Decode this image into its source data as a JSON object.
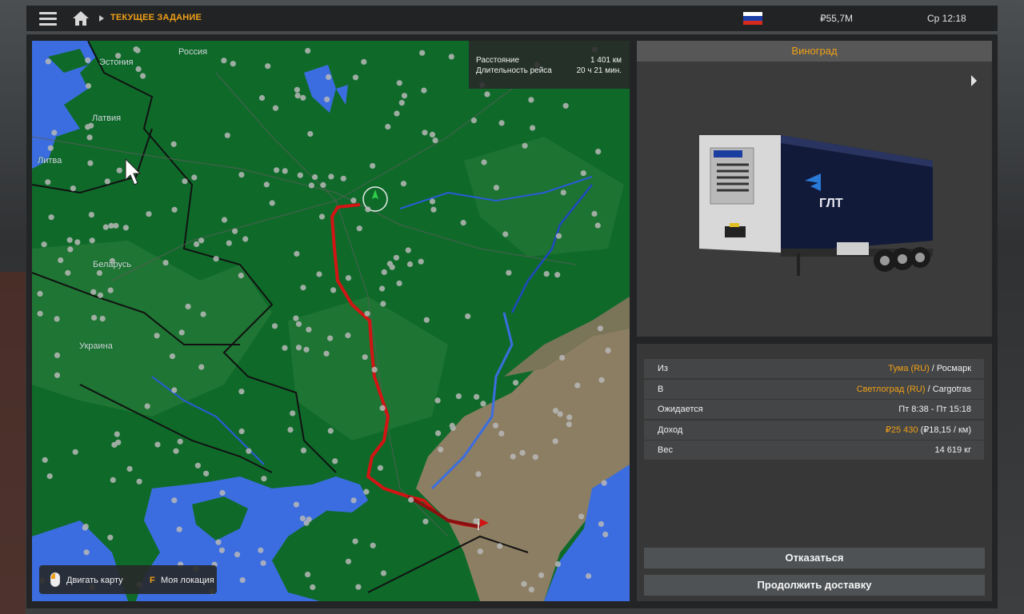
{
  "topbar": {
    "breadcrumb": "ТЕКУЩЕЕ ЗАДАНИЕ",
    "money": "₽55,7M",
    "clock": "Ср 12:18",
    "flag_colors": [
      "#ffffff",
      "#1c3ea8",
      "#d52b1e"
    ]
  },
  "map": {
    "labels": {
      "estonia": "Эстония",
      "russia": "Россия",
      "latvia": "Латвия",
      "lithuania": "Литва",
      "belarus": "Беларусь",
      "ukraine": "Украина"
    },
    "route_info": {
      "distance_label": "Расстояние",
      "distance_value": "1 401 км",
      "duration_label": "Длительность рейса",
      "duration_value": "20 ч 21 мин."
    },
    "hints": {
      "move_map": "Двигать карту",
      "key": "F",
      "my_location": "Моя локация"
    },
    "colors": {
      "land": "#0f6a2a",
      "sea": "#3b6de0",
      "steppe": "#8c7e63",
      "route": "#d21414"
    }
  },
  "cargo": {
    "title": "Виноград",
    "trailer_brand": "ГЛТ"
  },
  "details": {
    "from_label": "Из",
    "from_city": "Тума (RU)",
    "from_company": " / Росмарк",
    "to_label": "В",
    "to_city": "Светлоград (RU)",
    "to_company": " / Cargotras",
    "expected_label": "Ожидается",
    "expected_value": "Пт 8:38 - Пт 15:18",
    "income_label": "Доход",
    "income_value": "₽25 430",
    "income_rate": " (₽18,15 / км)",
    "weight_label": "Вес",
    "weight_value": "14 619 кг"
  },
  "buttons": {
    "decline": "Отказаться",
    "continue": "Продолжить доставку"
  }
}
